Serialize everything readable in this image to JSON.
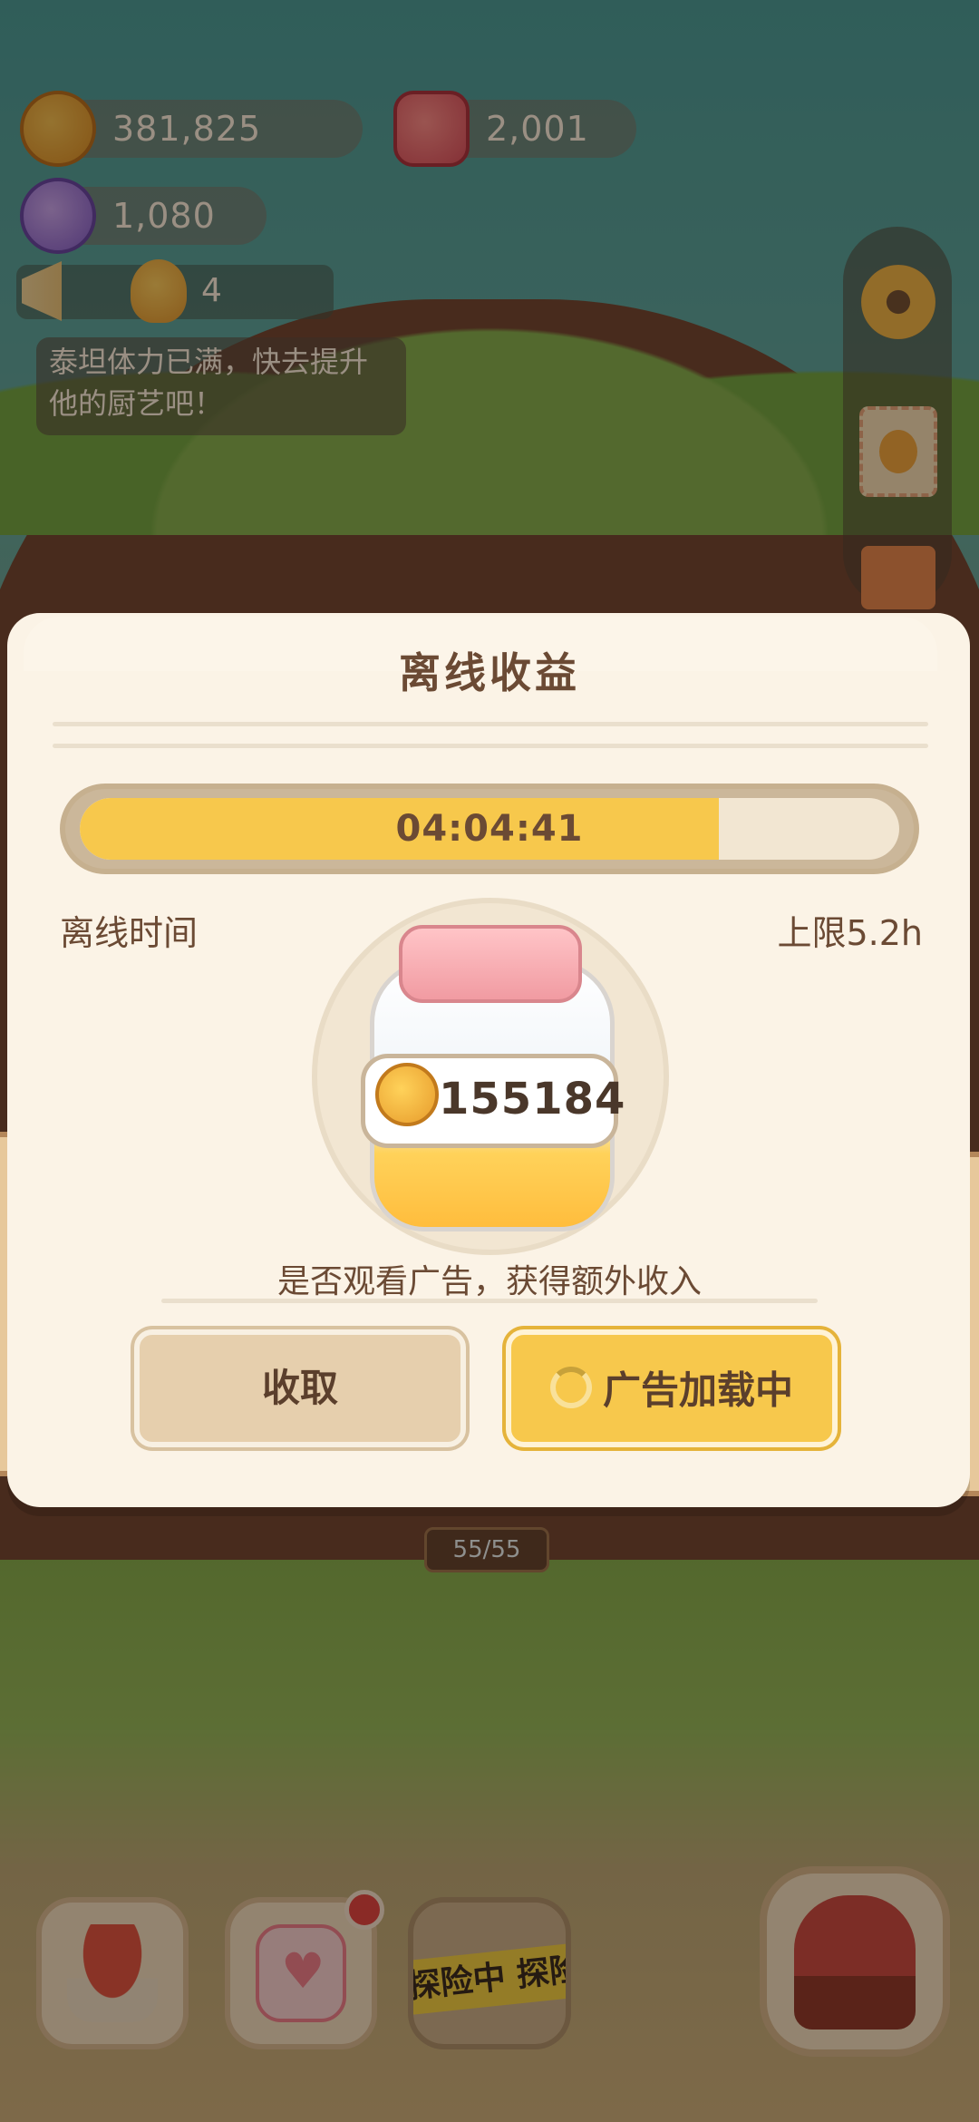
{
  "hud": {
    "cookies": "381,825",
    "jelly": "2,001",
    "candy": "1,080",
    "helpers": "4",
    "notice": "泰坦体力已满，快去提升他的厨艺吧！"
  },
  "modal": {
    "title": "离线收益",
    "progress_text": "04:04:41",
    "progress_fraction": 0.78,
    "offline_time_label": "离线时间",
    "cap_label": "上限5.2h",
    "reward_amount": "155184",
    "question": "是否观看广告，获得额外收入",
    "collect_button": "收取",
    "ad_button": "广告加载中"
  },
  "scene": {
    "energy": "55/55",
    "explore_tape": "探险中 探险"
  },
  "colors": {
    "accent_yellow": "#f7c84c",
    "paper": "#fbf3e6",
    "text_brown": "#6b4a34",
    "badge_red": "#e23c3c"
  }
}
